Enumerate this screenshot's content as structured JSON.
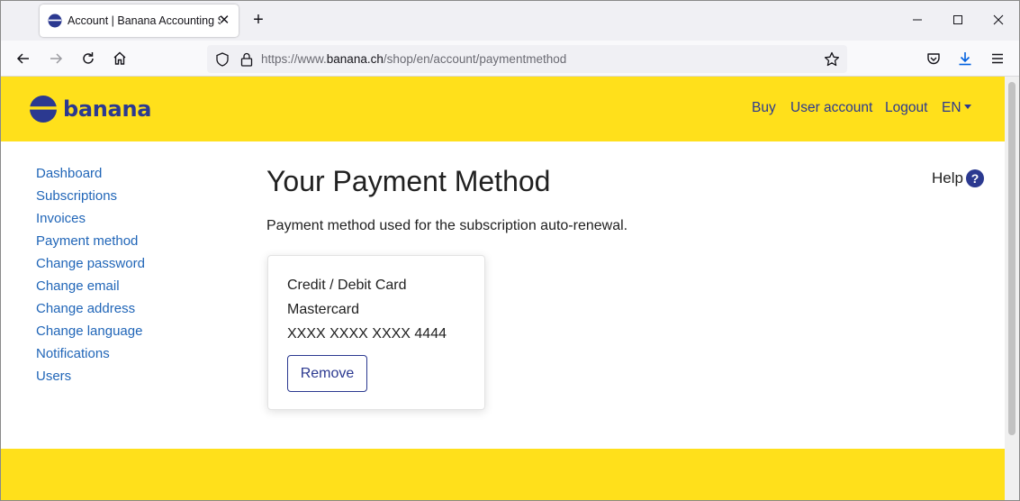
{
  "browser": {
    "tab_title": "Account | Banana Accounting S",
    "url_prefix": "https://www.",
    "url_domain": "banana.ch",
    "url_path": "/shop/en/account/paymentmethod"
  },
  "header": {
    "logo_text": "banana",
    "nav": {
      "buy": "Buy",
      "user_account": "User account",
      "logout": "Logout",
      "language": "EN"
    },
    "brand_color": "#ffe01b",
    "accent_color": "#2b3990"
  },
  "sidebar": {
    "items": [
      {
        "label": "Dashboard"
      },
      {
        "label": "Subscriptions"
      },
      {
        "label": "Invoices"
      },
      {
        "label": "Payment method"
      },
      {
        "label": "Change password"
      },
      {
        "label": "Change email"
      },
      {
        "label": "Change address"
      },
      {
        "label": "Change language"
      },
      {
        "label": "Notifications"
      },
      {
        "label": "Users"
      }
    ]
  },
  "main": {
    "title": "Your Payment Method",
    "help_label": "Help",
    "help_icon": "?",
    "description": "Payment method used for the subscription auto-renewal.",
    "card": {
      "type": "Credit / Debit Card",
      "brand": "Mastercard",
      "number": "XXXX XXXX XXXX 4444",
      "remove_label": "Remove"
    }
  }
}
